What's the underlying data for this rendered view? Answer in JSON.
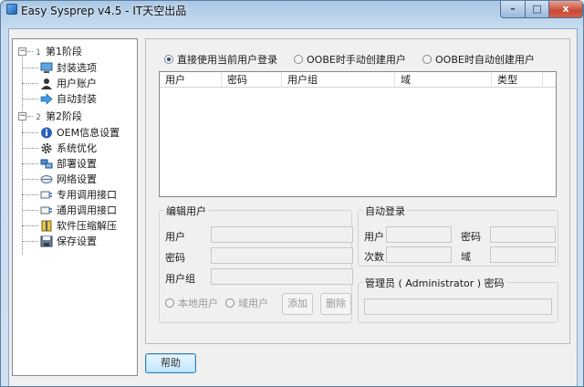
{
  "window": {
    "title": "Easy Sysprep v4.5 - IT天空出品",
    "minimize": "–",
    "maximize": "□",
    "close": "x"
  },
  "tree": {
    "stage1": {
      "num": "1",
      "label": "第1阶段"
    },
    "stage1_items": [
      "封装选项",
      "用户账户",
      "自动封装"
    ],
    "stage2": {
      "num": "2",
      "label": "第2阶段"
    },
    "stage2_items": [
      "OEM信息设置",
      "系统优化",
      "部署设置",
      "网络设置",
      "专用调用接口",
      "通用调用接口",
      "软件压缩解压",
      "保存设置"
    ]
  },
  "options": {
    "use_current": "直接使用当前用户登录",
    "oobe_manual": "OOBE时手动创建用户",
    "oobe_auto": "OOBE时自动创建用户",
    "selected": "use_current"
  },
  "user_list": {
    "columns": [
      "用户",
      "密码",
      "用户组",
      "域",
      "类型"
    ],
    "rows": []
  },
  "edit_user": {
    "title": "编辑用户",
    "user_label": "用户",
    "password_label": "密码",
    "group_label": "用户组",
    "local_user": "本地用户",
    "domain_user": "域用户",
    "add_button": "添加",
    "delete_button": "删除"
  },
  "auto_login": {
    "title": "自动登录",
    "user_label": "用户",
    "password_label": "密码",
    "count_label": "次数",
    "domain_label": "域"
  },
  "admin": {
    "title": "管理员 ( Administrator ) 密码"
  },
  "footer": {
    "help_button": "帮助"
  },
  "colors": {
    "title_gradient_top": "#a9c7e4",
    "close_red": "#c74a32",
    "selection_accent": "#1f4e93"
  }
}
